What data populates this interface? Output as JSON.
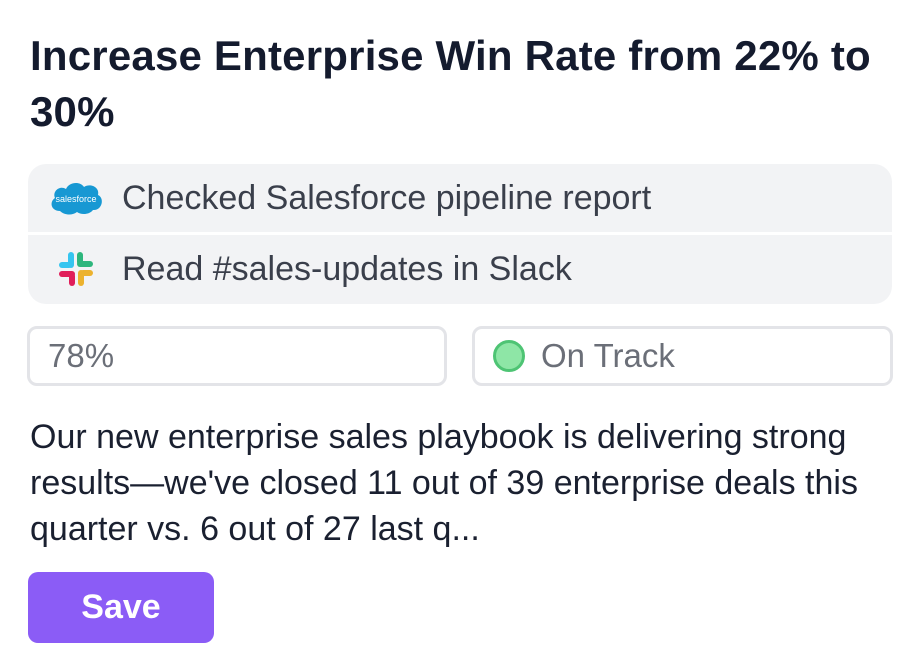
{
  "goal": {
    "title": "Increase Enterprise Win Rate from 22% to 30%"
  },
  "sources": {
    "items": [
      {
        "icon": "salesforce-icon",
        "logo_text": "salesforce",
        "label": "Checked Salesforce pipeline report"
      },
      {
        "icon": "slack-icon",
        "label": "Read #sales-updates in Slack"
      }
    ]
  },
  "fields": {
    "progress": {
      "value": "78%",
      "percent": 78
    },
    "status": {
      "value": "On Track",
      "color": "#8ee6a6"
    }
  },
  "description": {
    "text": "Our new enterprise sales playbook is delivering strong results—we've closed 11 out of 39 enterprise deals this quarter vs. 6 out of 27 last q..."
  },
  "actions": {
    "save_label": "Save"
  },
  "colors": {
    "accent": "#8b5cf6",
    "title": "#141b2e",
    "salesforce": "#1798d3"
  }
}
